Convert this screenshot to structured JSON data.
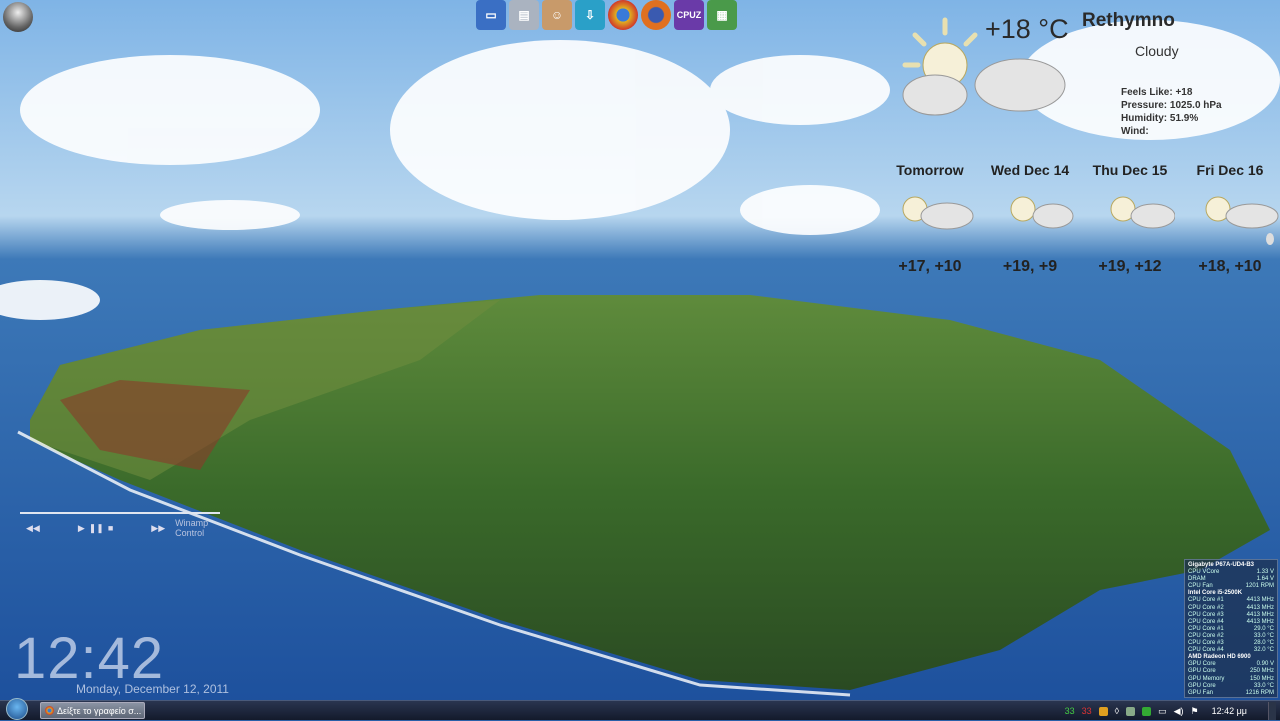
{
  "dock": {
    "icons": [
      "computer-icon",
      "drive-icon",
      "user-icon",
      "download-icon",
      "chrome-icon",
      "firefox-icon",
      "cpuz-icon",
      "hardware-icon"
    ],
    "cpuz_label": "CPUZ"
  },
  "weather": {
    "temp": "+18 °C",
    "city": "Rethymno",
    "condition": "Cloudy",
    "feels_like": "Feels Like: +18",
    "pressure": "Pressure: 1025.0 hPa",
    "humidity": "Humidity: 51.9%",
    "wind": "Wind:",
    "forecast": [
      {
        "day": "Tomorrow",
        "temps": "+17, +10"
      },
      {
        "day": "Wed Dec 14",
        "temps": "+19, +9"
      },
      {
        "day": "Thu Dec 15",
        "temps": "+19, +12"
      },
      {
        "day": "Fri Dec 16",
        "temps": "+18, +10"
      }
    ]
  },
  "player": {
    "title": "Winamp Control",
    "prev": "◀◀",
    "play": "▶",
    "pause": "❚❚",
    "stop": "■",
    "next": "▶▶"
  },
  "clock": {
    "time": "12:42",
    "date": "Monday, December 12, 2011"
  },
  "hw": {
    "groups": [
      {
        "title": "Gigabyte P67A-UD4-B3",
        "rows": [
          [
            "CPU VCore",
            "1.33 V"
          ],
          [
            "DRAM",
            "1.64 V"
          ],
          [
            "CPU Fan",
            "1201 RPM"
          ]
        ]
      },
      {
        "title": "Intel Core i5-2500K",
        "rows": [
          [
            "CPU Core #1",
            "4413 MHz"
          ],
          [
            "CPU Core #2",
            "4413 MHz"
          ],
          [
            "CPU Core #3",
            "4413 MHz"
          ],
          [
            "CPU Core #4",
            "4413 MHz"
          ],
          [
            "CPU Core #1",
            "29.0 °C"
          ],
          [
            "CPU Core #2",
            "33.0 °C"
          ],
          [
            "CPU Core #3",
            "28.0 °C"
          ],
          [
            "CPU Core #4",
            "32.0 °C"
          ]
        ]
      },
      {
        "title": "AMD Radeon HD 6900",
        "rows": [
          [
            "GPU Core",
            "0.90 V"
          ],
          [
            "GPU Core",
            "250 MHz"
          ],
          [
            "GPU Memory",
            "150 MHz"
          ],
          [
            "GPU Core",
            "33.0 °C"
          ],
          [
            "GPU Fan",
            "1216 RPM"
          ]
        ]
      }
    ]
  },
  "taskbar": {
    "window_label": "Δείξτε το γραφείο σ...",
    "tray_num1": "33",
    "tray_num2": "33",
    "time": "12:42 μμ"
  },
  "colors": {
    "sea": "#1f5aa8",
    "sky": "#9cc6ea",
    "island": "#3d6b2e"
  }
}
